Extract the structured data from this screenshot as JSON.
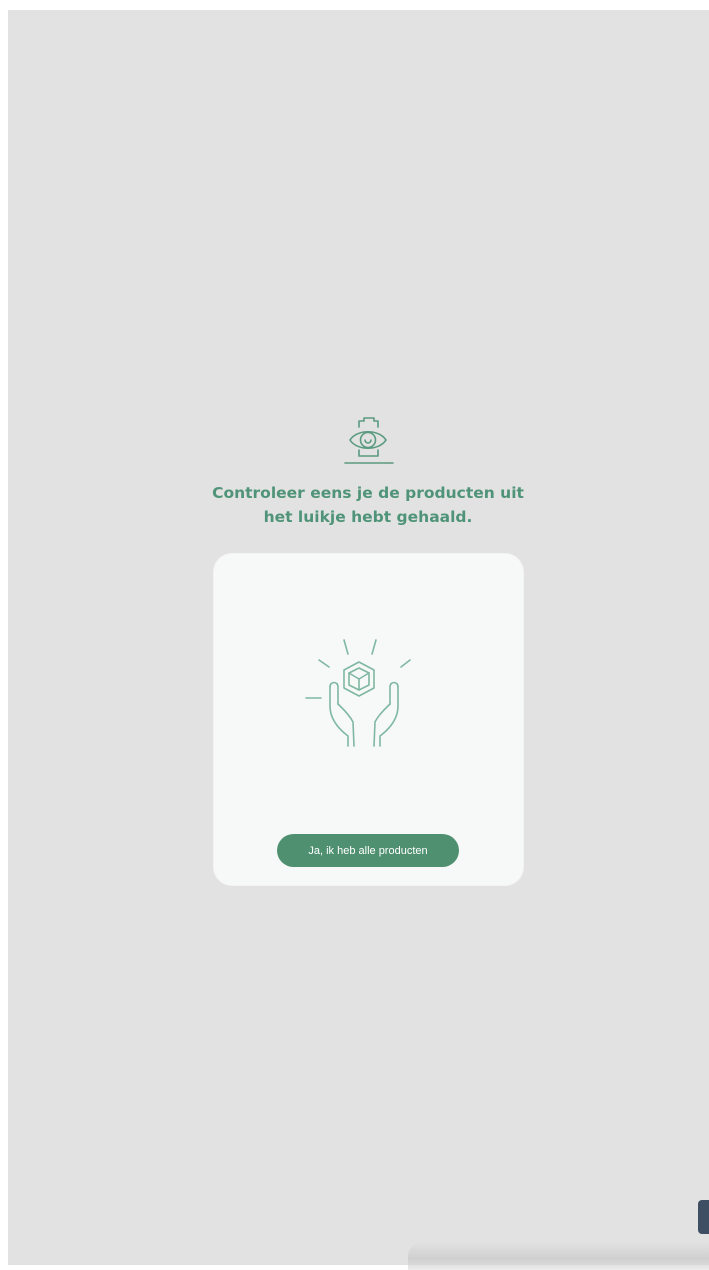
{
  "header": {
    "icon": "eye-inspect-icon",
    "title_line1": "Controleer eens je de producten uit",
    "title_line2": "het luikje hebt gehaald."
  },
  "card": {
    "illustration": "hands-holding-box-icon",
    "confirm_label": "Ja, ik heb alle producten"
  },
  "colors": {
    "background": "#e2e2e2",
    "card": "#f7f8f8",
    "accent": "#4f9478",
    "button": "#4e9070",
    "illustration_stroke": "#7fb8a2"
  }
}
